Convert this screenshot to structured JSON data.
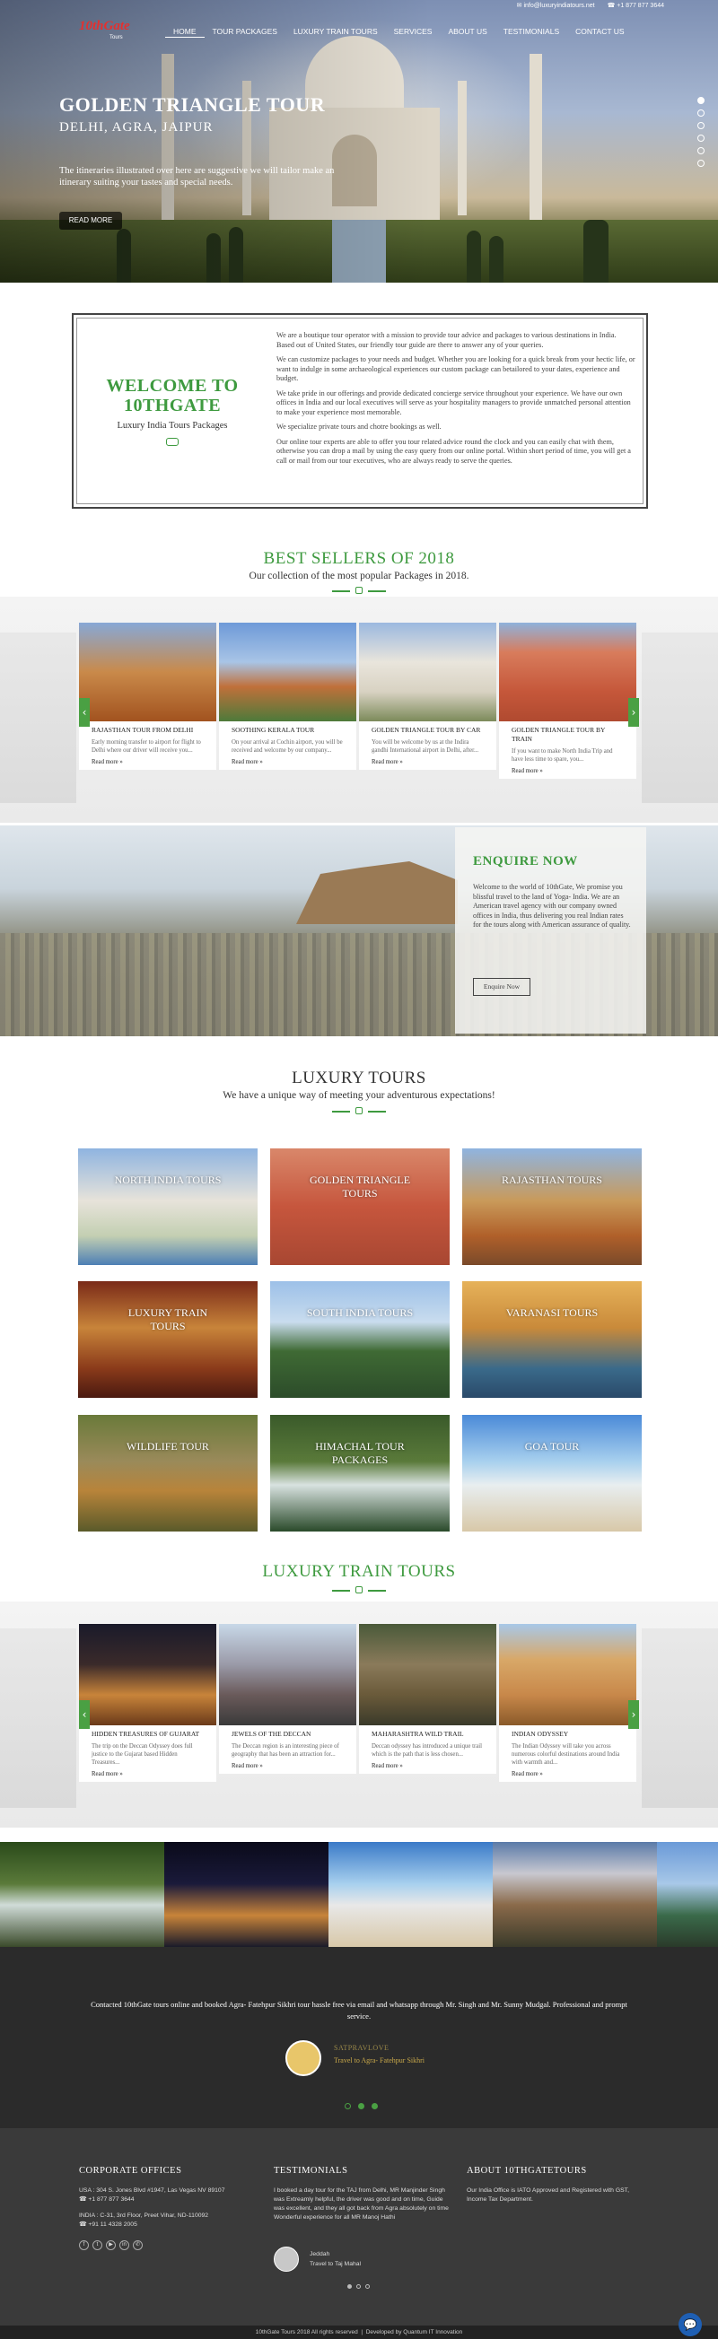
{
  "header": {
    "email": "info@luxuryindiatours.net",
    "phone": "+1 877 877 3644",
    "logo_text": "10thGate",
    "logo_sub": "Tours",
    "nav": [
      "Home",
      "Tour Packages",
      "Luxury Train Tours",
      "Services",
      "About Us",
      "Testimonials",
      "Contact Us"
    ]
  },
  "hero": {
    "title": "GOLDEN TRIANGLE TOUR",
    "subtitle": "DELHI, AGRA, JAIPUR",
    "description": "The itineraries illustrated over here are suggestive we will tailor make an itinerary suiting your tastes and special needs.",
    "button": "READ MORE",
    "slides": 6
  },
  "welcome": {
    "title": "WELCOME TO 10THGATE",
    "tagline": "Luxury India Tours Packages",
    "paragraphs": [
      "We are a boutique tour operator with a mission to provide tour advice and packages to various destinations in India.",
      "Based out of United States, our friendly tour guide are there to answer any of your queries.",
      "We can customize packages to your needs and budget. Whether you are looking for a quick break from your hectic life, or want to indulge in some archaeological experiences our custom package can betailored to your dates, experience and budget.",
      "We take pride in our offerings and provide dedicated concierge service throughout your experience. We have our own offices in India and our local executives will serve as your hospitality managers to provide unmatched personal attention to make your experience most memorable.",
      "We specialize private tours and chotre bookings as well.",
      "Our online tour experts are able to offer you tour related advice round the clock and you can easily chat with them, otherwise you can drop a mail by using the easy query from our online portal. Within short period of time, you will get a call or mail from our tour executives, who are always ready to serve the queries."
    ]
  },
  "best_sellers": {
    "title": "BEST SELLERS OF 2018",
    "subtitle": "Our collection of the most popular Packages in 2018.",
    "read_more": "Read more »",
    "cards": [
      {
        "title": "RAJASTHAN TOUR FROM DELHI",
        "desc": "Early morning transfer to airport for flight to Delhi where our driver will receive you..."
      },
      {
        "title": "SOOTHING KERALA TOUR",
        "desc": "On your arrival at Cochin airport, you will be received and welcome by our company..."
      },
      {
        "title": "GOLDEN TRIANGLE TOUR BY CAR",
        "desc": "You will be welcome by us at the Indira gandhi International airport in Delhi, after..."
      },
      {
        "title": "GOLDEN TRIANGLE TOUR BY TRAIN",
        "desc": "If you want to make North India Trip and have less time to spare, you..."
      }
    ]
  },
  "enquire": {
    "title": "ENQUIRE NOW",
    "text": "Welcome to the world of 10thGate, We promise you blissful travel to the land of Yoga- India. We are an American travel agency with our company owned offices in India, thus delivering you real Indian rates for the tours along with American assurance of quality.",
    "button": "Enquire Now"
  },
  "luxury_tours": {
    "title": "LUXURY TOURS",
    "subtitle": "We have a unique way of meeting your adventurous expectations!",
    "tiles": [
      "NORTH INDIA TOURS",
      "GOLDEN TRIANGLE TOURS",
      "RAJASTHAN TOURS",
      "LUXURY TRAIN TOURS",
      "SOUTH INDIA TOURS",
      "VARANASI TOURS",
      "WILDLIFE TOUR",
      "HIMACHAL TOUR PACKAGES",
      "GOA TOUR"
    ]
  },
  "train_tours": {
    "title": "LUXURY TRAIN TOURS",
    "read_more": "Read more »",
    "cards": [
      {
        "title": "HIDDEN TREASURES OF GUJARAT",
        "desc": "The trip on the Deccan Odyssey does full justice to the Gujarat based Hidden Treasures..."
      },
      {
        "title": "JEWELS OF THE DECCAN",
        "desc": "The Deccan region is an interesting piece of geography that has been an attraction for..."
      },
      {
        "title": "MAHARASHTRA WILD TRAIL",
        "desc": "Deccan odyssey has introduced a unique trail which is the path that is less chosen..."
      },
      {
        "title": "INDIAN ODYSSEY",
        "desc": "The Indian Odyssey will take you across numerous colorful destinations around India with warmth and..."
      }
    ]
  },
  "testimonial": {
    "quote": "Contacted 10thGate tours online and booked Agra- Fatehpur Sikhri tour hassle free via email and whatsapp through Mr. Singh and Mr. Sunny Mudgal. Professional and prompt service.",
    "name": "SATPRAVLOVE",
    "trip": "Travel to Agra- Fatehpur Sikhri"
  },
  "footer": {
    "corporate_title": "CORPORATE OFFICES",
    "usa": "USA : 304 S. Jones Blvd #1947, Las Vegas NV 89107",
    "usa_phone": "+1 877 877 3644",
    "india": "INDIA : C-31, 3rd Floor, Preet Vihar, ND-110092",
    "india_phone": "+91 11 4328 2005",
    "testimonials_title": "TESTIMONIALS",
    "testimonial_text": "I booked a day tour for the TAJ from Delhi, MR Manjinder Singh was Extreamly helpful, the driver was good and on time, Guide was excellent, and they all got back from Agra absolutely on time Wonderful experience for all MR Manoj Hathi",
    "testimonial_name": "Jeddah",
    "testimonial_trip": "Travel to Taj Mahal",
    "about_title": "ABOUT 10THGATETOURS",
    "about_text": "Our India Office is IATO Approved and Registered with GST, Income Tax Department.",
    "copyright": "10thGate Tours 2018 All rights reserved",
    "developer": "Developed by Quantum IT Innovation"
  },
  "colors": {
    "accent": "#3e9a3f",
    "footer": "#3a3a3a",
    "testimonial_bg": "#2b2b2b"
  }
}
